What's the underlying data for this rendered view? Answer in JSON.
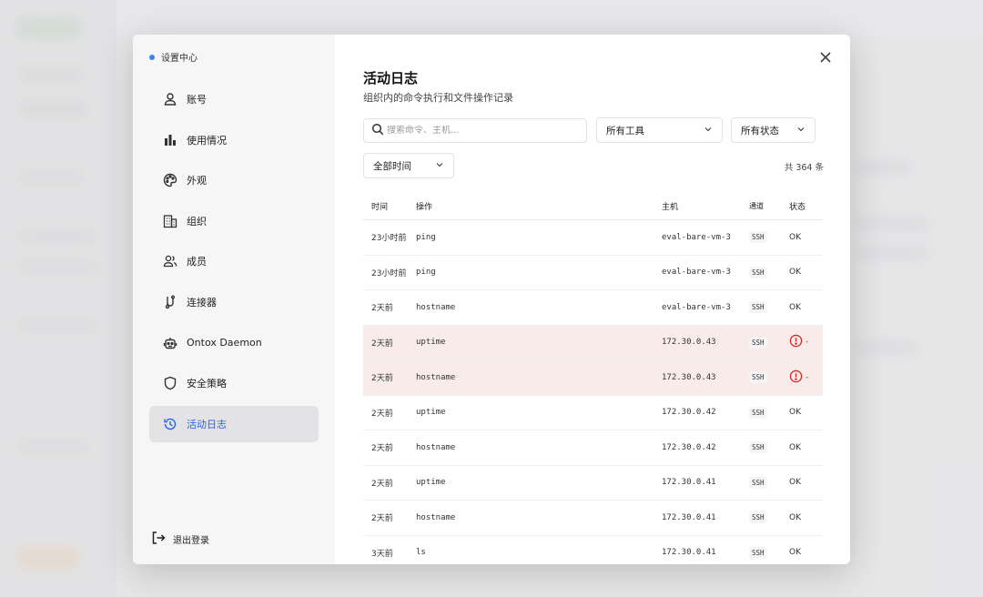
{
  "settings": {
    "title": "设置中心",
    "nav": [
      {
        "label": "账号",
        "icon": "user-icon"
      },
      {
        "label": "使用情况",
        "icon": "bar-chart-icon"
      },
      {
        "label": "外观",
        "icon": "palette-icon"
      },
      {
        "label": "组织",
        "icon": "building-icon"
      },
      {
        "label": "成员",
        "icon": "users-icon"
      },
      {
        "label": "连接器",
        "icon": "connector-icon"
      },
      {
        "label": "Ontox Daemon",
        "icon": "robot-icon"
      },
      {
        "label": "安全策略",
        "icon": "shield-icon"
      },
      {
        "label": "活动日志",
        "icon": "history-icon",
        "active": true
      }
    ],
    "logout": "退出登录"
  },
  "page": {
    "title": "活动日志",
    "subtitle": "组织内的命令执行和文件操作记录",
    "search_placeholder": "搜索命令、主机...",
    "tool_filter": "所有工具",
    "status_filter": "所有状态",
    "time_filter": "全部时间",
    "count": "共 364 条"
  },
  "table": {
    "headers": {
      "time": "时间",
      "op": "操作",
      "host": "主机",
      "channel": "通道",
      "status": "状态"
    },
    "rows": [
      {
        "time": "23小时前",
        "op": "ping",
        "host": "eval-bare-vm-3",
        "channel": "SSH",
        "status": "OK",
        "error": false
      },
      {
        "time": "23小时前",
        "op": "ping",
        "host": "eval-bare-vm-3",
        "channel": "SSH",
        "status": "OK",
        "error": false
      },
      {
        "time": "2天前",
        "op": "hostname",
        "host": "eval-bare-vm-3",
        "channel": "SSH",
        "status": "OK",
        "error": false
      },
      {
        "time": "2天前",
        "op": "uptime",
        "host": "172.30.0.43",
        "channel": "SSH",
        "status": "-",
        "error": true
      },
      {
        "time": "2天前",
        "op": "hostname",
        "host": "172.30.0.43",
        "channel": "SSH",
        "status": "-",
        "error": true
      },
      {
        "time": "2天前",
        "op": "uptime",
        "host": "172.30.0.42",
        "channel": "SSH",
        "status": "OK",
        "error": false
      },
      {
        "time": "2天前",
        "op": "hostname",
        "host": "172.30.0.42",
        "channel": "SSH",
        "status": "OK",
        "error": false
      },
      {
        "time": "2天前",
        "op": "uptime",
        "host": "172.30.0.41",
        "channel": "SSH",
        "status": "OK",
        "error": false
      },
      {
        "time": "2天前",
        "op": "hostname",
        "host": "172.30.0.41",
        "channel": "SSH",
        "status": "OK",
        "error": false
      },
      {
        "time": "3天前",
        "op": "ls",
        "host": "172.30.0.41",
        "channel": "SSH",
        "status": "OK",
        "error": false
      }
    ]
  },
  "colors": {
    "accent": "#2563eb",
    "error_row": "#f8ecea",
    "error_icon": "#dc2626",
    "dot": "#3b82f6"
  }
}
